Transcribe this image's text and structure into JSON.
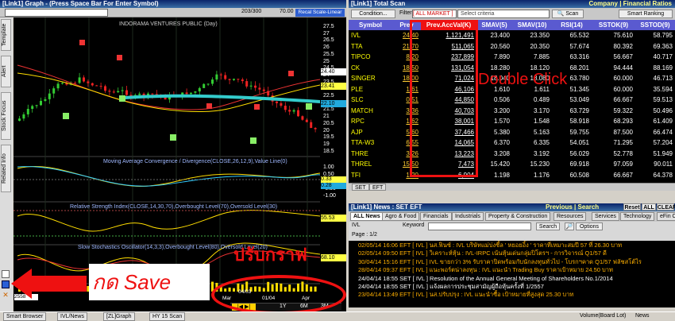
{
  "graph": {
    "title": "[Link1] Graph - (Press Space Bar For Enter Symbol)",
    "count": "203/300",
    "price_box": "70.00",
    "scale_label": "Recal Scale-Linear",
    "stock_name": "INDORAMA VENTURES PUBLIC (Day)",
    "side_tabs": [
      "Template",
      "Alert",
      "Stock Focus",
      "Related Info"
    ],
    "price_axis": [
      "27.5",
      "27",
      "26.5",
      "26",
      "25.5",
      "25",
      "24.5",
      "24",
      "23.5",
      "23",
      "22.5",
      "22",
      "21.5",
      "21",
      "20.5",
      "20",
      "19.5",
      "19",
      "18.5"
    ],
    "price_tags": {
      "top": "24.40",
      "mid": "23.41",
      "low": "22.10"
    },
    "macd_label": "Moving Average Convergence / Divergence(CLOSE,26,12,9),Value Line(0)",
    "macd_axis": [
      "1.00",
      "0.50",
      "0.00",
      "-0.50",
      "-1.00"
    ],
    "macd_tags": [
      "0.33",
      "0.28"
    ],
    "rsi_label": "Relative Strength Index(CLOSE,14,30,70),Overbought Level(70),Oversold Level(30)",
    "rsi_tag": "55.53",
    "stoch_label": "Slow Stochastics Oscillator(14,3,3),Overbought Level(80),Oversold Level(20)",
    "stoch_tag": "68.10",
    "volume_value": "2558",
    "dates": [
      "Mar",
      "01/04",
      "Apr"
    ],
    "date_label": "04/03",
    "periods": [
      "1Y",
      "6M",
      "3M"
    ],
    "annotation_save": "กด Save",
    "annotation_adjust": "ปรับกราฟ",
    "annotation_double": "Double Click"
  },
  "scan": {
    "title": "[Link1] Total Scan",
    "title_right": "Company | Financial Ratios",
    "condition_label": "Condition...",
    "filter_label": "Filter",
    "filter_value": "[ ALL MARKET ]",
    "criteria_placeholder": "Select criteria",
    "scan_label": "Scan",
    "ranking_label": "Smart Ranking",
    "columns": [
      "Symbol",
      "Prev",
      "Prev.AccVal(K)",
      "SMAV(5)",
      "SMAV(10)",
      "RSI(14)",
      "SSTOK(9)",
      "SSTOD(9)"
    ],
    "rows": [
      [
        "IVL",
        "24.40",
        "1,121,491",
        "23.400",
        "23.350",
        "65.532",
        "75.610",
        "58.795"
      ],
      [
        "TTA",
        "21.70",
        "511,065",
        "20.560",
        "20.350",
        "57.674",
        "80.392",
        "69.363"
      ],
      [
        "TIPCO",
        "8.20",
        "237,899",
        "7.890",
        "7.885",
        "63.316",
        "56.667",
        "40.717"
      ],
      [
        "CK",
        "18.50",
        "131,054",
        "18.280",
        "18.120",
        "68.201",
        "94.444",
        "88.169"
      ],
      [
        "SINGER",
        "18.00",
        "71,024",
        "18.040",
        "18.080",
        "63.780",
        "60.000",
        "46.713"
      ],
      [
        "PLE",
        "1.61",
        "46,106",
        "1.610",
        "1.611",
        "51.345",
        "60.000",
        "35.594"
      ],
      [
        "SLC",
        "0.51",
        "44,850",
        "0.506",
        "0.489",
        "53.049",
        "66.667",
        "59.513"
      ],
      [
        "MATCH",
        "3.36",
        "40,703",
        "3.200",
        "3.170",
        "63.729",
        "59.322",
        "50.496"
      ],
      [
        "RPC",
        "1.62",
        "38,001",
        "1.570",
        "1.548",
        "58.918",
        "68.293",
        "61.409"
      ],
      [
        "AJP",
        "5.60",
        "37,466",
        "5.380",
        "5.163",
        "59.755",
        "87.500",
        "66.474"
      ],
      [
        "TTA-W3",
        "6.55",
        "14,065",
        "6.370",
        "6.335",
        "54.051",
        "71.295",
        "57.204"
      ],
      [
        "THRE",
        "3.26",
        "13,223",
        "3.208",
        "3.192",
        "56.029",
        "52.778",
        "51.949"
      ],
      [
        "THREL",
        "15.50",
        "7,473",
        "15.420",
        "15.230",
        "69.918",
        "97.059",
        "90.011"
      ],
      [
        "TFI",
        "1.20",
        "6,904",
        "1.198",
        "1.176",
        "60.508",
        "66.667",
        "64.378"
      ]
    ],
    "sub_tabs": [
      "SET",
      "EFT"
    ]
  },
  "news": {
    "title": "[Link1] News : SET EFT",
    "title_right": "Previous | Search",
    "window_buttons": [
      "Reset",
      "ALL",
      "CLEAR"
    ],
    "tabs": [
      "ALL News",
      "Agro & Food",
      "Financials",
      "Industrials",
      "Property & Construction",
      "Resources",
      "Services",
      "Technology",
      "eFin C"
    ],
    "symbol": "IVL",
    "keyword_label": "Keyword",
    "search_label": "Search",
    "options_label": "Options",
    "page": "Page : 1/2",
    "rows": [
      "02/05/14 16:06  EFT  [ IVL ]  นส.ฟินซ์ : IVL บริษัทแม่บ่งชี้ล ' หยอยอิ้ง ' ราคาที่เหมาะสมปี 57 ที่ 26.30 บาท",
      "02/05/14 09:50  EFT  [ IVL ]  วิเคราะห์หุ้น : IVL-IRPC  เน้นหุ้นเด่นกลุ่มปิโตรฯ - การวิจารณ์ Q1/57 ดี",
      "30/04/14 15:16  EFT  [ IVL ]  IVL ขายกว่า 3% รับราคาปิดพร้อมกับนักลงทุนทั่วไป - โบรกฯคาด Q1/57 ฟลัชสโต้ไร",
      "28/04/14 09:37  EFT  [ IVL ]  แนะพอร์ตน่าลงทุน : IVL แนะนำ Trading Buy ราคาเป้าหมาย 24.50 บาท",
      "24/04/14 18:55  SET  [ IVL ]  Resolution of the Annual General Meeting of Shareholders No.1/2014",
      "24/04/14 18:55  SET  [ IVL ]  แจ้งผลการประชุมสามัญผู้ถือหุ้นครั้งที่ 1/2557",
      "23/04/14 13:49  EFT  [ IVL ]  นส.ปรับปรุง : IVL แนะนำซื้อ เป้าหมายที่สูงสุด 25.30 บาท"
    ]
  },
  "taskbar": {
    "items": [
      "Smart Browser",
      "IVL/News",
      "[ZL]Graph",
      "HY 15 Scan"
    ],
    "right_label": "Volume(Board Lot)",
    "right_tab": "News"
  },
  "colors": {
    "accent_red": "#e11",
    "title_blue": "#0a246a",
    "header_purple": "#5a5ad0",
    "cyan_band": "#3cc",
    "yellow_text": "#ffff00"
  }
}
